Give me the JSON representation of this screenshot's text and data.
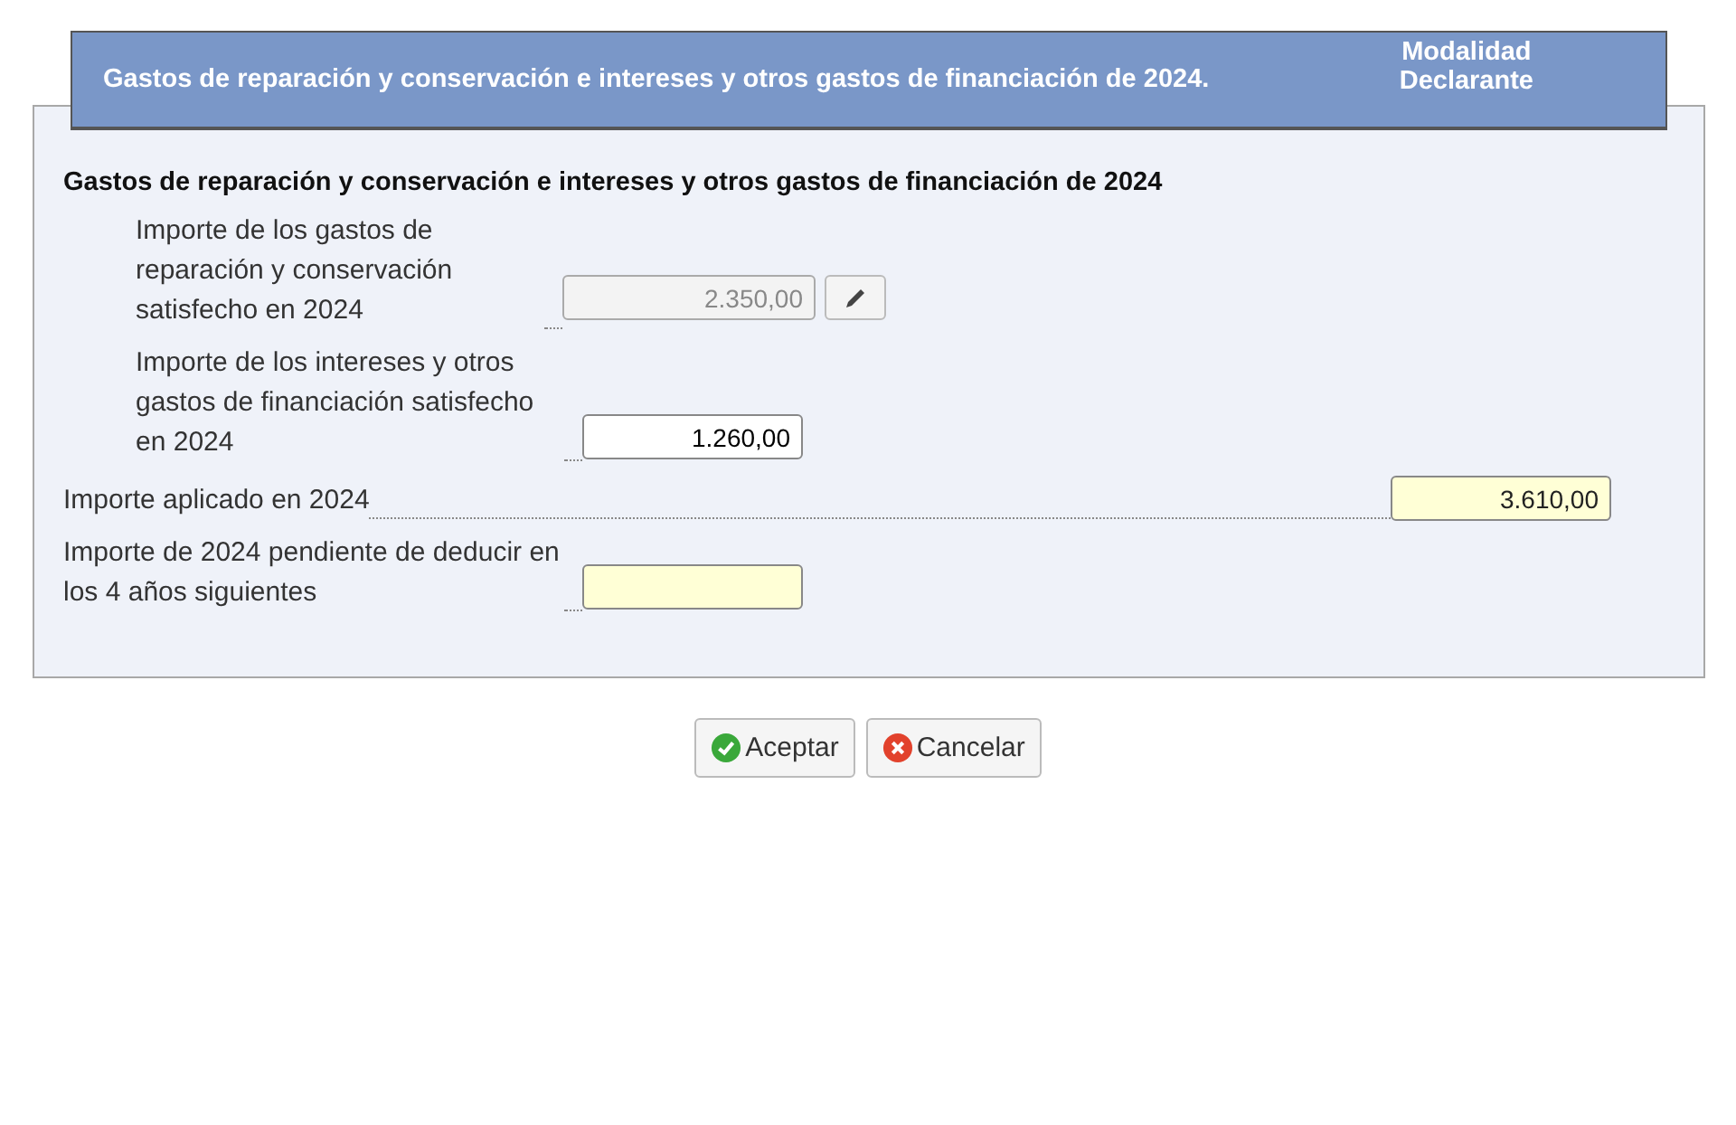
{
  "header": {
    "title": "Gastos de reparación y conservación e intereses y otros gastos de financiación de 2024.",
    "mode_lines": [
      "Modalidad",
      "Declarante"
    ]
  },
  "section_title": "Gastos de reparación y conservación e intereses y otros gastos de financiación de 2024",
  "components": [
    {
      "label": "Importe de los gastos de reparación y conservación satisfecho en 2024",
      "kind": "locked",
      "value": "2.350,00"
    },
    {
      "label": "Importe de los intereses y otros gastos de financiación satisfecho en 2024",
      "kind": "input",
      "value": "1.260,00"
    }
  ],
  "totals": [
    {
      "label": "Importe aplicado en 2024",
      "kind": "result",
      "value": "3.610,00"
    },
    {
      "label": "Importe de 2024 pendiente de deducir en los 4 años siguientes",
      "kind": "pending"
    }
  ],
  "buttons": [
    {
      "label": "Aceptar",
      "kind": "accept"
    },
    {
      "label": "Cancelar",
      "kind": "cancel"
    }
  ]
}
